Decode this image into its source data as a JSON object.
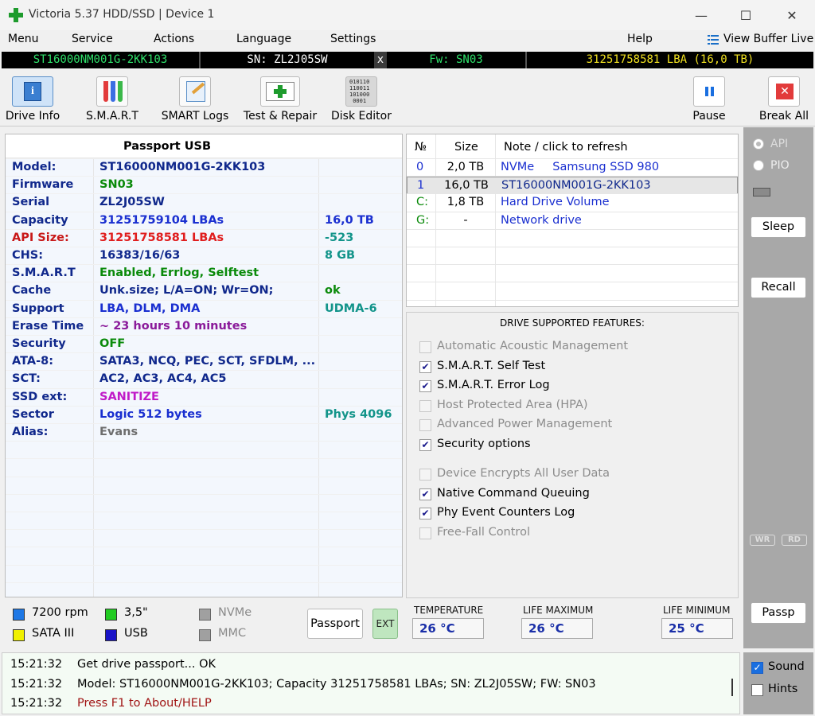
{
  "window": {
    "title": "Victoria 5.37 HDD/SSD | Device 1",
    "minimize": "—",
    "maximize": "☐",
    "close": "✕"
  },
  "menu": {
    "items": [
      "Menu",
      "Service",
      "Actions",
      "Language",
      "Settings",
      "Help"
    ],
    "view_buffer": "View Buffer Live"
  },
  "drivebar": {
    "model": "ST16000NM001G-2KK103",
    "serial": "SN: ZL2J05SW",
    "close": "x",
    "firmware": "Fw: SN03",
    "lba": "31251758581 LBA (16,0 TB)"
  },
  "toolbar": {
    "drive_info": "Drive Info",
    "smart": "S.M.A.R.T",
    "smart_logs": "SMART Logs",
    "test_repair": "Test & Repair",
    "disk_editor": "Disk Editor",
    "pause": "Pause",
    "break_all": "Break All",
    "disk_editor_glyph": "010110\n110011\n101000\n0001"
  },
  "info": {
    "header": "Passport USB",
    "rows": [
      {
        "key": "Model:",
        "value": "ST16000NM001G-2KK103",
        "extra": "",
        "vcolor": "#10288c",
        "xcolor": "#10288c"
      },
      {
        "key": "Firmware",
        "value": "SN03",
        "extra": "",
        "vcolor": "#0a8a0a",
        "xcolor": "#10288c"
      },
      {
        "key": "Serial",
        "value": "ZL2J05SW",
        "extra": "",
        "vcolor": "#10288c",
        "xcolor": "#10288c"
      },
      {
        "key": "Capacity",
        "value": "31251759104 LBAs",
        "extra": "16,0 TB",
        "vcolor": "#1a2fd0",
        "xcolor": "#1a2fd0"
      },
      {
        "key": "API Size:",
        "value": "31251758581 LBAs",
        "extra": "-523",
        "vcolor": "#e01e1e",
        "xcolor": "#12948a",
        "kcolor": "#c81818"
      },
      {
        "key": "CHS:",
        "value": "16383/16/63",
        "extra": "8 GB",
        "vcolor": "#10288c",
        "xcolor": "#12948a"
      },
      {
        "key": "S.M.A.R.T",
        "value": "Enabled, Errlog, Selftest",
        "extra": "",
        "vcolor": "#0a8a0a",
        "xcolor": "#10288c"
      },
      {
        "key": "Cache",
        "value": "Unk.size; L/A=ON; Wr=ON;",
        "extra": "ok",
        "vcolor": "#10288c",
        "xcolor": "#0a8a0a"
      },
      {
        "key": "Support",
        "value": "LBA, DLM, DMA",
        "extra": "UDMA-6",
        "vcolor": "#1a2fd0",
        "xcolor": "#12948a"
      },
      {
        "key": "Erase Time",
        "value": "~ 23 hours 10 minutes",
        "extra": "",
        "vcolor": "#8a1a9a",
        "xcolor": "#10288c"
      },
      {
        "key": "Security",
        "value": "OFF",
        "extra": "",
        "vcolor": "#0a8a0a",
        "xcolor": "#10288c"
      },
      {
        "key": "ATA-8:",
        "value": "SATA3, NCQ, PEC, SCT, SFDLM, ...",
        "extra": "",
        "vcolor": "#10288c",
        "xcolor": "#10288c"
      },
      {
        "key": "SCT:",
        "value": "AC2, AC3, AC4, AC5",
        "extra": "",
        "vcolor": "#10288c",
        "xcolor": "#10288c"
      },
      {
        "key": "SSD ext:",
        "value": "SANITIZE",
        "extra": "",
        "vcolor": "#c01ac8",
        "xcolor": "#10288c"
      },
      {
        "key": "Sector",
        "value": "Logic 512 bytes",
        "extra": "Phys 4096",
        "vcolor": "#1a2fd0",
        "xcolor": "#12948a"
      },
      {
        "key": "Alias:",
        "value": "Evans",
        "extra": "",
        "vcolor": "#6e6e6e",
        "xcolor": "#10288c"
      }
    ]
  },
  "drives": {
    "headers": [
      "№",
      "Size",
      "Note / click to refresh"
    ],
    "rows": [
      {
        "num": "0",
        "size": "2,0 TB",
        "note": "NVMe     Samsung SSD 980",
        "color": "#1a2fd0",
        "selected": false
      },
      {
        "num": "1",
        "size": "16,0 TB",
        "note": "ST16000NM001G-2KK103",
        "color": "#10288c",
        "selected": true
      },
      {
        "num": "C:",
        "size": "1,8 TB",
        "note": "Hard Drive Volume",
        "color": "#1a2fd0",
        "selected": false,
        "numcolor": "#0a8a0a"
      },
      {
        "num": "G:",
        "size": "-",
        "note": "Network drive",
        "color": "#1a2fd0",
        "selected": false,
        "numcolor": "#0a8a0a"
      }
    ]
  },
  "features": {
    "title": "DRIVE SUPPORTED FEATURES:",
    "items": [
      {
        "label": "Automatic Acoustic Management",
        "checked": false,
        "enabled": false
      },
      {
        "label": "S.M.A.R.T. Self Test",
        "checked": true,
        "enabled": true
      },
      {
        "label": "S.M.A.R.T. Error Log",
        "checked": true,
        "enabled": true
      },
      {
        "label": "Host Protected Area (HPA)",
        "checked": false,
        "enabled": false
      },
      {
        "label": "Advanced Power Management",
        "checked": false,
        "enabled": false
      },
      {
        "label": "Security options",
        "checked": true,
        "enabled": true
      },
      {
        "label": "Device Encrypts All User Data",
        "checked": false,
        "enabled": false
      },
      {
        "label": "Native Command Queuing",
        "checked": true,
        "enabled": true
      },
      {
        "label": "Phy Event Counters Log",
        "checked": true,
        "enabled": true
      },
      {
        "label": "Free-Fall Control",
        "checked": false,
        "enabled": false
      }
    ]
  },
  "side": {
    "api": "API",
    "pio": "PIO",
    "sleep": "Sleep",
    "recall": "Recall",
    "wr": "WR",
    "rd": "RD",
    "passp": "Passp"
  },
  "legend": {
    "rpm": "7200 rpm",
    "form": "3,5\"",
    "nvme": "NVMe",
    "sata": "SATA III",
    "usb": "USB",
    "mmc": "MMC",
    "colors": {
      "rpm": "#1e78e6",
      "form": "#22cc22",
      "nvme": "#a0a0a0",
      "sata": "#f0f000",
      "usb": "#1a14c8",
      "mmc": "#a0a0a0"
    },
    "passport_button": "Passport",
    "ext_button": "EXT"
  },
  "temps": {
    "temperature_label": "TEMPERATURE",
    "temperature": "26 °C",
    "life_max_label": "LIFE MAXIMUM",
    "life_max": "26 °C",
    "life_min_label": "LIFE MINIMUM",
    "life_min": "25 °C"
  },
  "log": [
    {
      "time": "15:21:32",
      "msg": "Get drive passport... OK",
      "color": "#000000"
    },
    {
      "time": "15:21:32",
      "msg": "Model: ST16000NM001G-2KK103; Capacity 31251758581 LBAs; SN: ZL2J05SW; FW: SN03",
      "color": "#000000"
    },
    {
      "time": "15:21:32",
      "msg": "Press F1 to About/HELP",
      "color": "#a01414"
    }
  ],
  "bottom": {
    "sound": "Sound",
    "hints": "Hints",
    "sound_checked": true,
    "hints_checked": false
  }
}
